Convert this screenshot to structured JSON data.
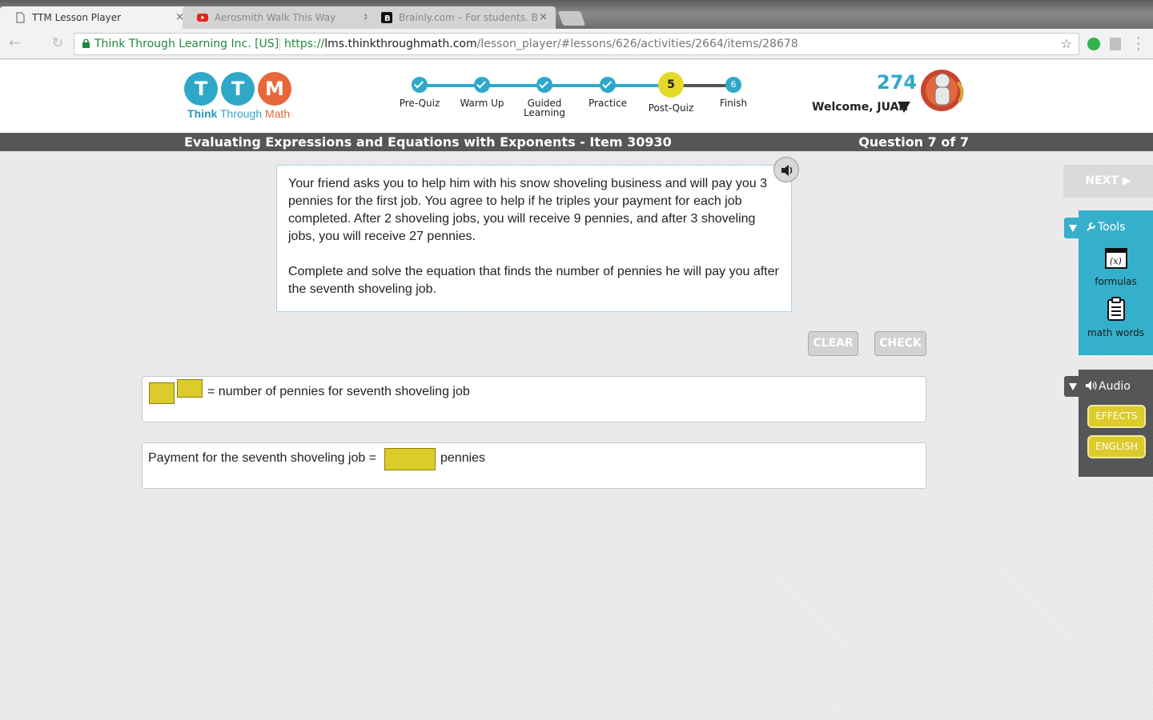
{
  "browser": {
    "tabs": [
      {
        "title": "TTM Lesson Player",
        "close": "×"
      },
      {
        "title": "Aerosmith Walk This Way",
        "close": "×"
      },
      {
        "title": "Brainly.com – For students. B",
        "close": "×"
      }
    ],
    "address_bar": {
      "org": "Think Through Learning Inc. [US]",
      "protocol": "https://",
      "host": "lms.thinkthroughmath.com",
      "path": "/lesson_player/#lessons/626/activities/2664/items/28678"
    }
  },
  "logo": {
    "letters": [
      "T",
      "T",
      "M"
    ],
    "word_think": "Think",
    "word_through": "Through",
    "word_math": "Math"
  },
  "progress": {
    "steps": [
      {
        "label": "Pre-Quiz",
        "state": "done"
      },
      {
        "label": "Warm Up",
        "state": "done"
      },
      {
        "label_line1": "Guided",
        "label_line2": "Learning",
        "state": "done"
      },
      {
        "label": "Practice",
        "state": "done"
      },
      {
        "label": "Post-Quiz",
        "number": "5",
        "state": "current"
      },
      {
        "label": "Finish",
        "number": "6",
        "state": "upcoming"
      }
    ]
  },
  "user": {
    "points": "274",
    "welcome": "Welcome, JUAN"
  },
  "lesson": {
    "title": "Evaluating Expressions and Equations with Exponents - Item 30930",
    "question_counter": "Question 7 of 7"
  },
  "question": {
    "paragraph1": "Your friend asks you to help him with his snow shoveling business and will pay you 3 pennies for the first job. You agree to help if he triples your payment for each job completed. After 2 shoveling jobs, you will receive 9 pennies, and after 3 shoveling jobs, you will receive 27 pennies.",
    "paragraph2": "Complete and solve the equation that finds the number of pennies he will pay you after the seventh shoveling job."
  },
  "actions": {
    "clear_label": "CLEAR",
    "check_label": "CHECK",
    "next_label": "NEXT ▶"
  },
  "answers": {
    "row1_text": "= number of pennies for seventh shoveling job",
    "row2_prefix": "Payment for the seventh shoveling job =",
    "row2_suffix": "pennies"
  },
  "tools": {
    "title": "Tools",
    "items": [
      {
        "label": "formulas",
        "icon": "formula-icon"
      },
      {
        "label": "math words",
        "icon": "clipboard-icon"
      }
    ]
  },
  "audio": {
    "title": "Audio",
    "effects_label": "EFFECTS",
    "english_label": "ENGLISH"
  },
  "colors": {
    "teal": "#2fa8c8",
    "orange": "#e8673a",
    "yellow": "#dccb2a",
    "dark_gray": "#555658"
  }
}
